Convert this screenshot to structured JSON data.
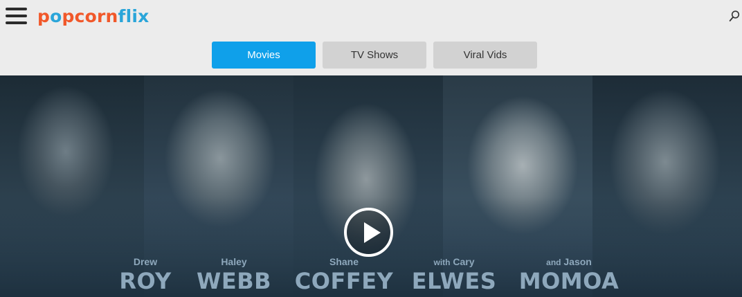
{
  "header": {
    "logo_text": "popcornflix",
    "logo_parts": [
      "p",
      "o",
      "pcorn",
      "flix"
    ],
    "menu_icon": "hamburger-menu-icon",
    "search_icon": "search-icon"
  },
  "tabs": [
    {
      "label": "Movies",
      "active": true
    },
    {
      "label": "TV Shows",
      "active": false
    },
    {
      "label": "Viral Vids",
      "active": false
    }
  ],
  "hero": {
    "play_icon": "play-icon",
    "cast": [
      {
        "first": "Drew",
        "prefix": "",
        "last": "ROY"
      },
      {
        "first": "Haley",
        "prefix": "",
        "last": "WEBB"
      },
      {
        "first": "Shane",
        "prefix": "",
        "last": "COFFEY"
      },
      {
        "first": "Cary",
        "prefix": "with",
        "last": "ELWES"
      },
      {
        "first": "Jason",
        "prefix": "and",
        "last": "MOMOA"
      }
    ]
  },
  "colors": {
    "logo_orange": "#f1582a",
    "logo_blue": "#2aa5d9",
    "active_tab": "#0fa0ea",
    "inactive_tab": "#d2d2d2",
    "credit_text": "#8ea8bc"
  }
}
